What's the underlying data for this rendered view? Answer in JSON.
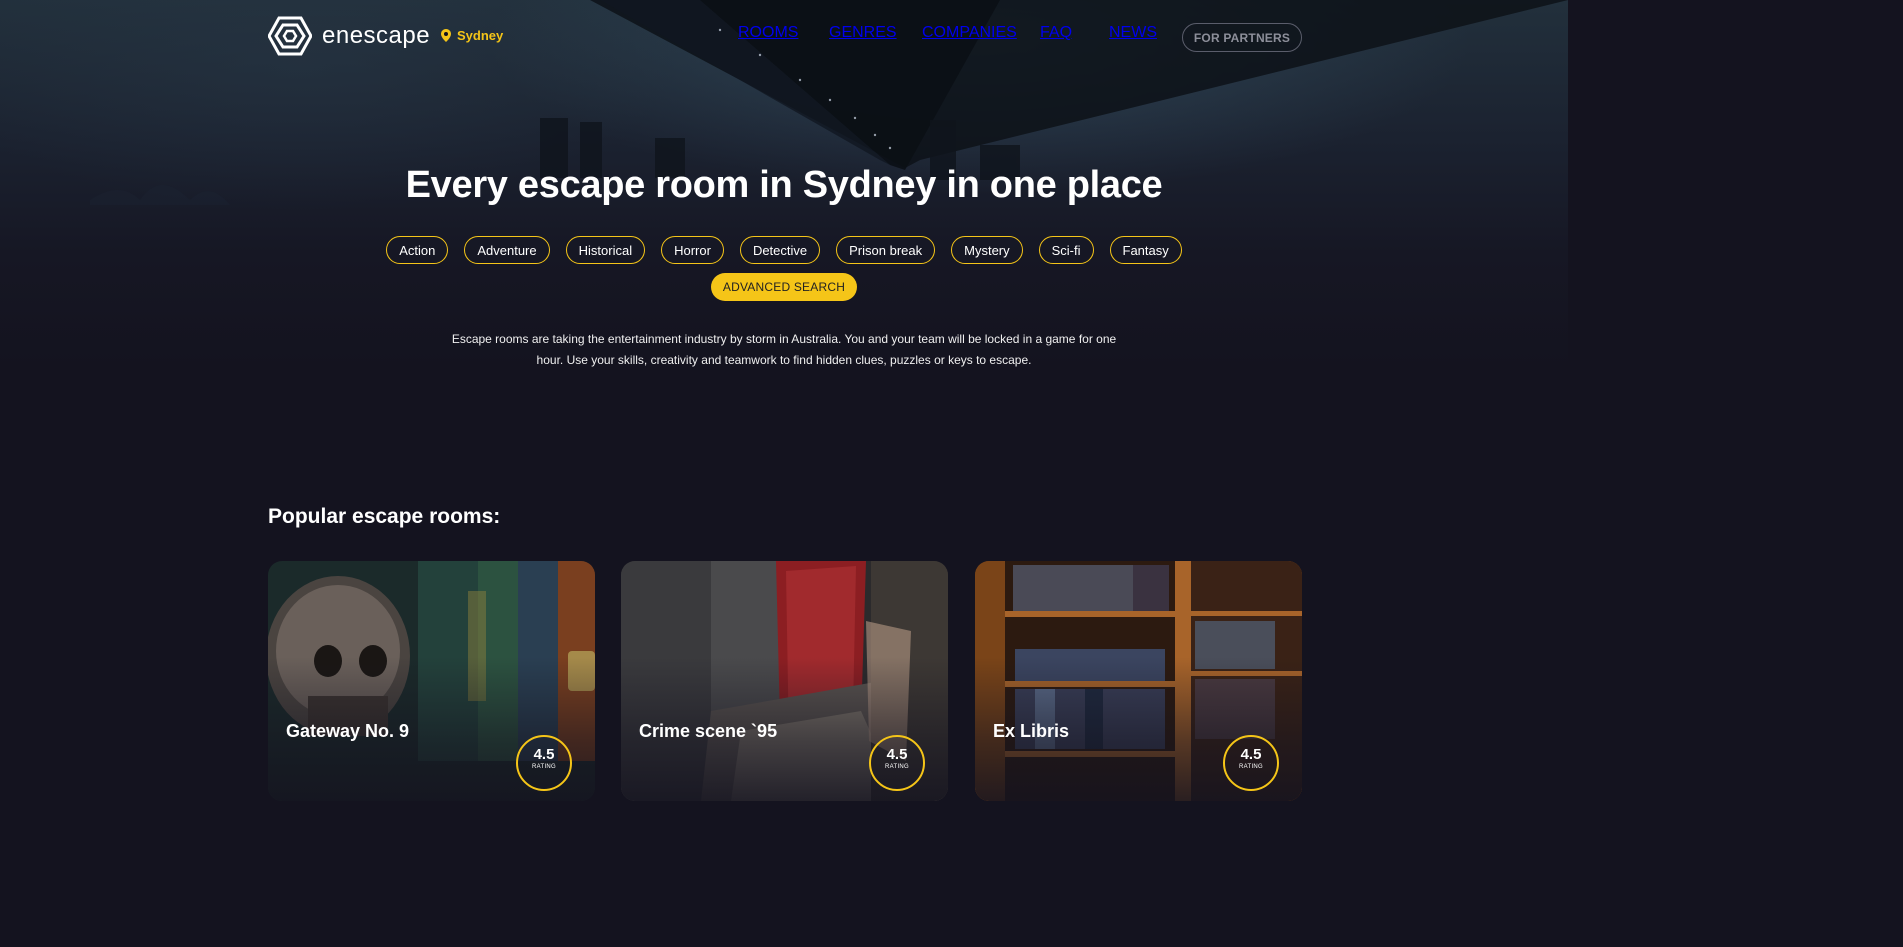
{
  "brand": {
    "name": "enescape",
    "city": "Sydney"
  },
  "nav": {
    "items": [
      "ROOMS",
      "GENRES",
      "COMPANIES",
      "FAQ",
      "NEWS"
    ],
    "partners": "FOR PARTNERS"
  },
  "hero": {
    "title": "Every escape room in Sydney in one place",
    "genres": [
      "Action",
      "Adventure",
      "Historical",
      "Horror",
      "Detective",
      "Prison break",
      "Mystery",
      "Sci-fi",
      "Fantasy"
    ],
    "advanced_search": "ADVANCED SEARCH",
    "description": "Escape rooms are taking the entertainment industry by storm in Australia. You and your team will be locked in a game for one hour. Use your skills, creativity and teamwork to find hidden clues, puzzles or keys to escape."
  },
  "popular": {
    "title": "Popular escape rooms:",
    "rooms": [
      {
        "name": "Gateway No. 9",
        "rating": "4.5",
        "rating_label": "RATING"
      },
      {
        "name": "Crime scene `95",
        "rating": "4.5",
        "rating_label": "RATING"
      },
      {
        "name": "Ex Libris",
        "rating": "4.5",
        "rating_label": "RATING"
      }
    ]
  },
  "colors": {
    "accent": "#f5c518",
    "background": "#14131f"
  }
}
